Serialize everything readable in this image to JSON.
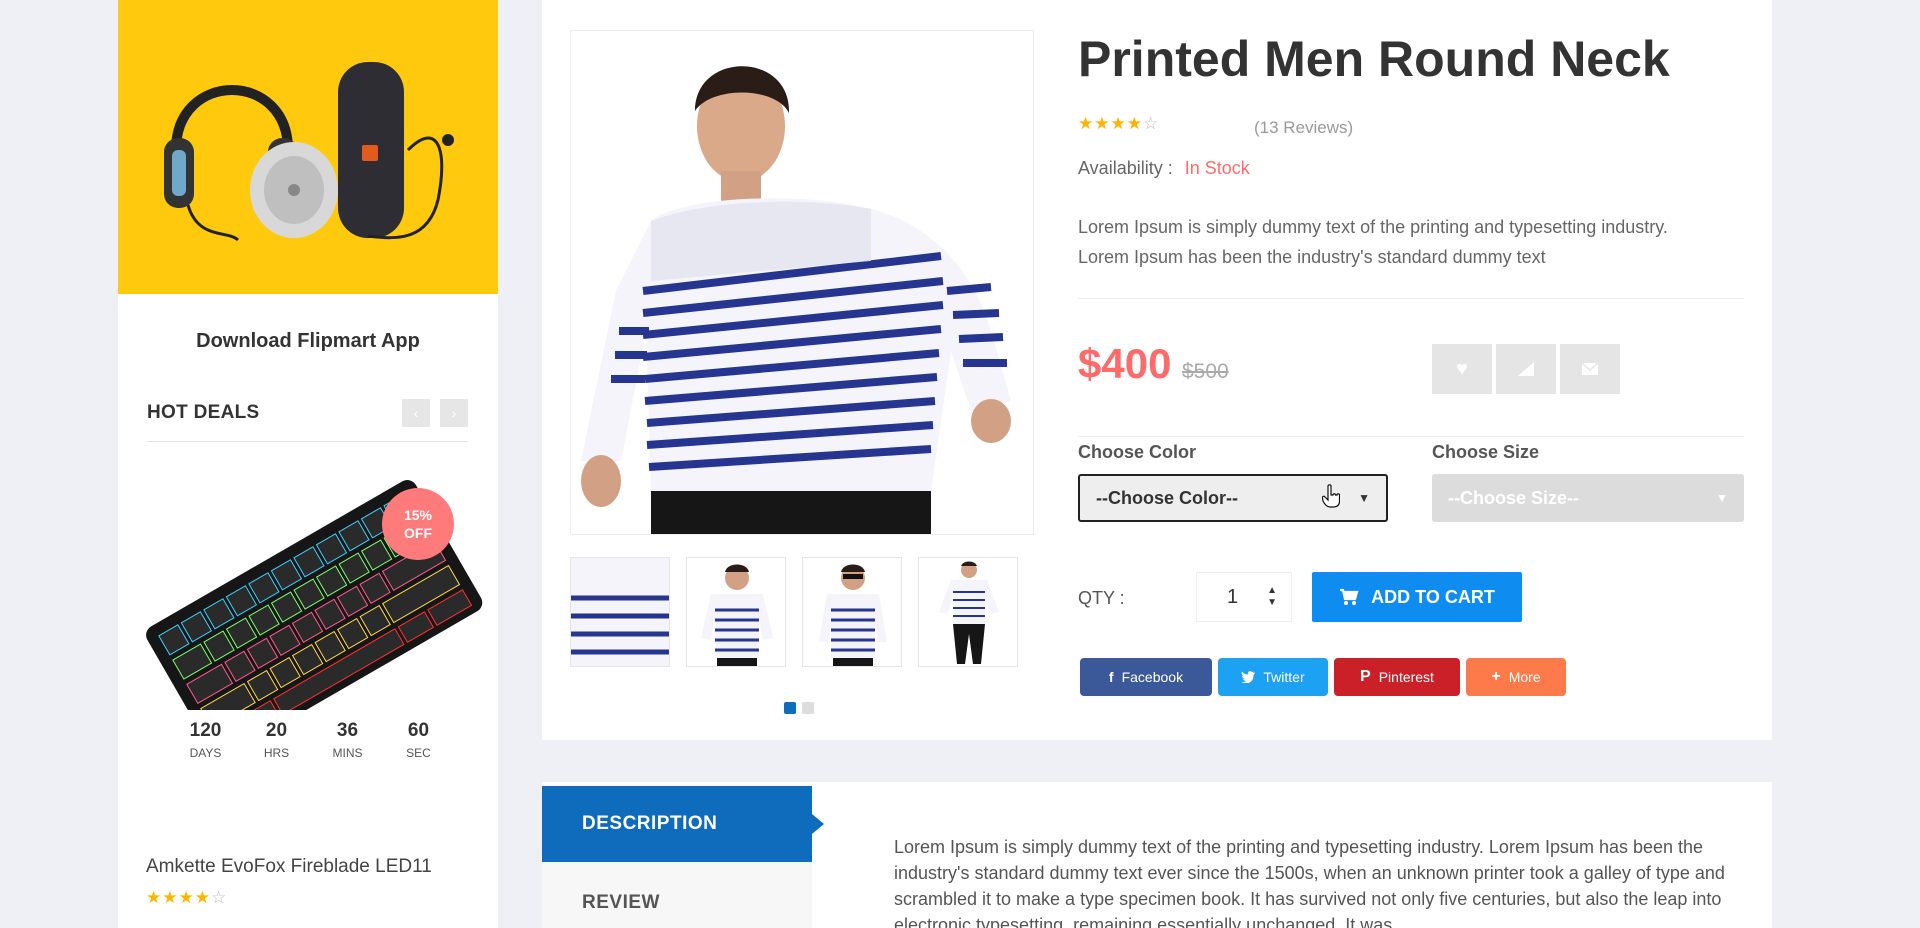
{
  "sidebar": {
    "app_banner_title": "Download Flipmart App",
    "hot_deals": {
      "title": "HOT DEALS",
      "prev_icon": "chevron-left-icon",
      "next_icon": "chevron-right-icon",
      "discount_line1": "15%",
      "discount_line2": "OFF",
      "countdown": [
        {
          "value": "120",
          "unit": "DAYS"
        },
        {
          "value": "20",
          "unit": "HRS"
        },
        {
          "value": "36",
          "unit": "MINS"
        },
        {
          "value": "60",
          "unit": "SEC"
        }
      ],
      "product_name": "Amkette EvoFox Fireblade LED11",
      "rating": 4,
      "rating_max": 5
    }
  },
  "product": {
    "title": "Printed Men Round Neck",
    "rating": 4,
    "rating_max": 5,
    "reviews": "(13 Reviews)",
    "availability_label": "Availability :",
    "availability_value": "In Stock",
    "short_desc_line1": "Lorem Ipsum is simply dummy text of the printing and typesetting industry.",
    "short_desc_line2": "Lorem Ipsum has been the industry's standard dummy text",
    "price": "$400",
    "old_price": "$500",
    "actions": [
      "heart-icon",
      "signal-icon",
      "envelope-icon"
    ],
    "choose_color_label": "Choose Color",
    "choose_color_value": "--Choose Color--",
    "choose_size_label": "Choose Size",
    "choose_size_value": "--Choose Size--",
    "qty_label": "QTY :",
    "qty_value": "1",
    "add_to_cart": "ADD TO CART",
    "share": {
      "facebook": "Facebook",
      "twitter": "Twitter",
      "pinterest": "Pinterest",
      "more": "More"
    },
    "carousel_dots": 2,
    "carousel_active": 0
  },
  "tabs": {
    "description": "DESCRIPTION",
    "review": "REVIEW",
    "description_text": "Lorem Ipsum is simply dummy text of the printing and typesetting industry. Lorem Ipsum has been the industry's standard dummy text ever since the 1500s, when an unknown printer took a galley of type and scrambled it to make a type specimen book. It has survived not only five centuries, but also the leap into electronic typesetting, remaining essentially unchanged. It was"
  },
  "colors": {
    "accent_blue": "#0f6cbd",
    "cart_blue": "#0f8cf0",
    "price_red": "#ff6b6b",
    "banner_yellow": "#ffc90e",
    "star": "#ffb400"
  }
}
